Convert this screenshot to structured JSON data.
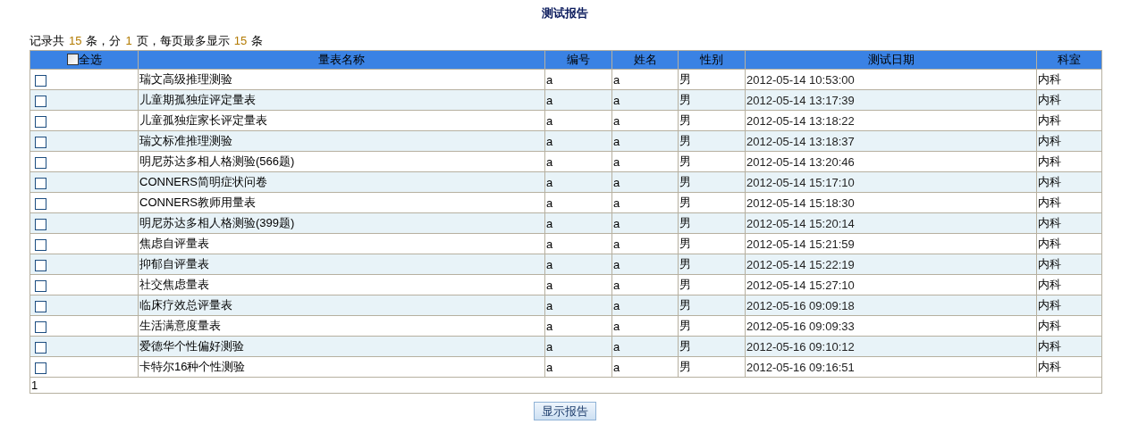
{
  "title": "测试报告",
  "summary": {
    "prefix": "记录共",
    "total": "15",
    "unit1": "条，分",
    "pages": "1",
    "unit2": "页，每页最多显示",
    "per_page": "15",
    "unit3": "条"
  },
  "table": {
    "select_all": {
      "label": "全选",
      "checked": false
    },
    "columns": [
      "量表名称",
      "编号",
      "姓名",
      "性别",
      "测试日期",
      "科室"
    ],
    "rows": [
      {
        "checked": false,
        "cells": [
          "瑞文高级推理测验",
          "a",
          "a",
          "男",
          "2012-05-14 10:53:00",
          "内科"
        ]
      },
      {
        "checked": false,
        "cells": [
          "儿童期孤独症评定量表",
          "a",
          "a",
          "男",
          "2012-05-14 13:17:39",
          "内科"
        ]
      },
      {
        "checked": false,
        "cells": [
          "儿童孤独症家长评定量表",
          "a",
          "a",
          "男",
          "2012-05-14 13:18:22",
          "内科"
        ]
      },
      {
        "checked": false,
        "cells": [
          "瑞文标准推理测验",
          "a",
          "a",
          "男",
          "2012-05-14 13:18:37",
          "内科"
        ]
      },
      {
        "checked": false,
        "cells": [
          "明尼苏达多相人格测验(566题)",
          "a",
          "a",
          "男",
          "2012-05-14 13:20:46",
          "内科"
        ]
      },
      {
        "checked": false,
        "cells": [
          "CONNERS简明症状问卷",
          "a",
          "a",
          "男",
          "2012-05-14 15:17:10",
          "内科"
        ]
      },
      {
        "checked": false,
        "cells": [
          "CONNERS教师用量表",
          "a",
          "a",
          "男",
          "2012-05-14 15:18:30",
          "内科"
        ]
      },
      {
        "checked": false,
        "cells": [
          "明尼苏达多相人格测验(399题)",
          "a",
          "a",
          "男",
          "2012-05-14 15:20:14",
          "内科"
        ]
      },
      {
        "checked": false,
        "cells": [
          "焦虑自评量表",
          "a",
          "a",
          "男",
          "2012-05-14 15:21:59",
          "内科"
        ]
      },
      {
        "checked": false,
        "cells": [
          "抑郁自评量表",
          "a",
          "a",
          "男",
          "2012-05-14 15:22:19",
          "内科"
        ]
      },
      {
        "checked": false,
        "cells": [
          "社交焦虑量表",
          "a",
          "a",
          "男",
          "2012-05-14 15:27:10",
          "内科"
        ]
      },
      {
        "checked": false,
        "cells": [
          "临床疗效总评量表",
          "a",
          "a",
          "男",
          "2012-05-16 09:09:18",
          "内科"
        ]
      },
      {
        "checked": false,
        "cells": [
          "生活满意度量表",
          "a",
          "a",
          "男",
          "2012-05-16 09:09:33",
          "内科"
        ]
      },
      {
        "checked": false,
        "cells": [
          "爱德华个性偏好测验",
          "a",
          "a",
          "男",
          "2012-05-16 09:10:12",
          "内科"
        ]
      },
      {
        "checked": false,
        "cells": [
          "卡特尔16种个性测验",
          "a",
          "a",
          "男",
          "2012-05-16 09:16:51",
          "内科"
        ]
      }
    ],
    "pager": "1"
  },
  "button": "显示报告"
}
